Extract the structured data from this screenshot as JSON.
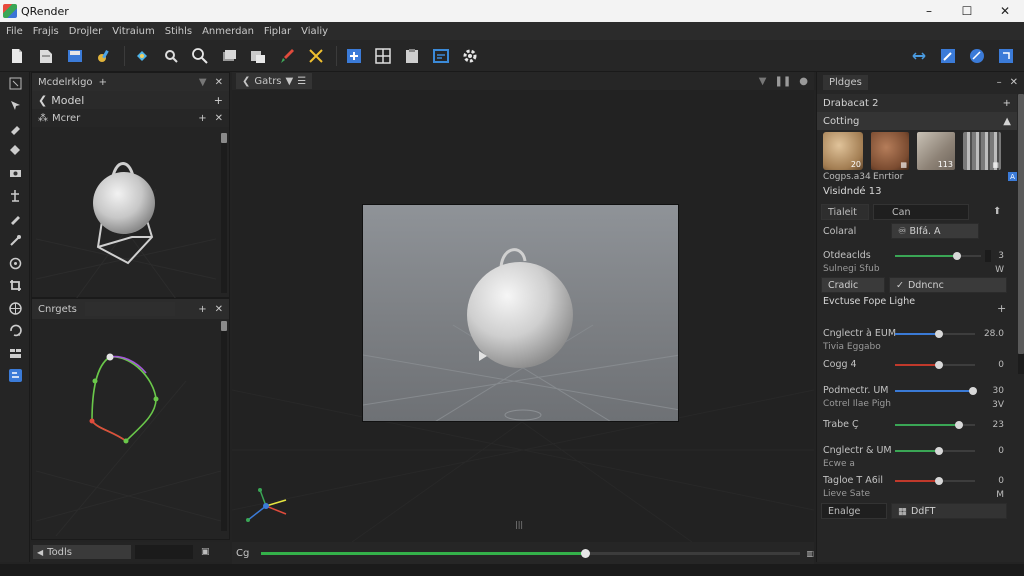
{
  "window": {
    "title": "QRender",
    "minimize": "–",
    "maximize": "☐",
    "close": "✕"
  },
  "menu": [
    "File",
    "Frajis",
    "Drojler",
    "Vitraium",
    "Stihls",
    "Anmerdan",
    "Fiplar",
    "Vialiy"
  ],
  "toolbar": {
    "left_icons": [
      "new-file-icon",
      "open-file-icon",
      "save-icon",
      "paint-icon",
      "transform-icon",
      "zoom-in-icon",
      "search-icon",
      "layers-icon",
      "duplicate-icon",
      "brush-icon",
      "cut-icon",
      "add-icon",
      "grid-icon",
      "clipboard-icon",
      "frame-icon",
      "settings-icon"
    ],
    "right_icons": [
      "link-icon",
      "edit-icon",
      "globe-icon",
      "expand-icon"
    ]
  },
  "left_tools": [
    "select-icon",
    "move-icon",
    "rotate-icon",
    "camera-icon",
    "text-icon",
    "pen-icon",
    "eyedropper-icon",
    "target-icon",
    "crop-icon",
    "globe-icon",
    "rotate-tool-icon",
    "layers-icon",
    "python-icon"
  ],
  "modeling_panel": {
    "title": "Mcdelrkigo",
    "plus": "+",
    "subheader": "Model",
    "subheader_add": "+",
    "item_label": "Mcrer",
    "item_add": "+",
    "item_close": "✕"
  },
  "curves_panel": {
    "title": "Cnrgets",
    "add": "+",
    "close": "✕"
  },
  "bottom_left": {
    "label": "Todls"
  },
  "viewport": {
    "tab_label": "Gatrs"
  },
  "timeline": {
    "label": "Cg",
    "value": 0.6,
    "marker": "|||"
  },
  "properties": {
    "title": "Pldges",
    "close": "–",
    "x": "✕",
    "row1": "Drabacat 2",
    "row1_add": "+",
    "section1": "Cotting",
    "materials": [
      {
        "name": "wood",
        "tag": "20"
      },
      {
        "name": "leather",
        "tag": ""
      },
      {
        "name": "tile",
        "tag": "113"
      },
      {
        "name": "metal",
        "tag": ""
      }
    ],
    "mat_caption1": "Cogps.a34",
    "mat_caption2": "Enrtior",
    "section2": "Visidndé 13",
    "tolerance_label": "Tialeit",
    "tolerance_value": "Can",
    "control_label": "Colaral",
    "control_value": "♾ BIfá. A",
    "sliders_a": [
      {
        "label": "Otdeaclds",
        "sublabel": "Sulnegi Sfub",
        "value": "3",
        "pos": 0.72,
        "color": "#3aa655",
        "unit": "W"
      }
    ],
    "btn_left": "Cradic",
    "btn_right": "Ddncnc",
    "section3": "Evctuse Fope Lighe",
    "section3_add": "+",
    "sliders": [
      {
        "label": "Cnglectr à EUM",
        "sublabel": "Tivia Eggabo",
        "value": "28.0",
        "pos": 0.55,
        "color": "#3a7ad6",
        "unit": ""
      },
      {
        "label": "Cogg 4",
        "sublabel": "",
        "value": "0",
        "pos": 0.55,
        "color": "#c0392b",
        "unit": ""
      },
      {
        "label": "Podmectr. UM",
        "sublabel": "Cotrel Ilae Pigh",
        "value": "30",
        "pos": 0.98,
        "color": "#3a7ad6",
        "unit": "3V"
      },
      {
        "label": "Trabe Ç",
        "sublabel": "",
        "value": "23",
        "pos": 0.8,
        "color": "#3aa655",
        "unit": ""
      },
      {
        "label": "Cnglectr & UM",
        "sublabel": "Ecwe a",
        "value": "0",
        "pos": 0.55,
        "color": "#3aa655",
        "unit": ""
      },
      {
        "label": "Tagloe T A6il",
        "sublabel": "Lieve Sate",
        "value": "0",
        "pos": 0.55,
        "color": "#c0392b",
        "unit": "M"
      }
    ],
    "footer_left": "Enalge",
    "footer_right": "DdFT"
  }
}
